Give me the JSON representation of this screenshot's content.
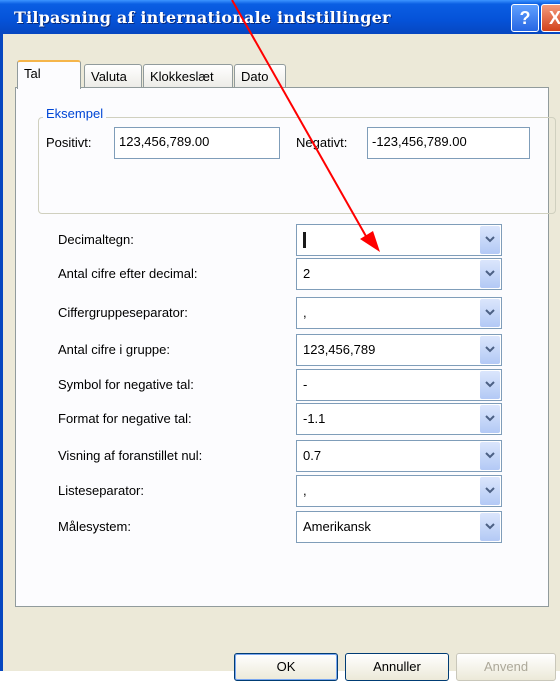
{
  "window": {
    "title": "Tilpasning af internationale indstillinger",
    "help_icon": "?",
    "close_icon": "X"
  },
  "tabs": [
    {
      "label": "Tal",
      "active": true
    },
    {
      "label": "Valuta",
      "active": false
    },
    {
      "label": "Klokkeslæt",
      "active": false
    },
    {
      "label": "Dato",
      "active": false
    }
  ],
  "example": {
    "group_label": "Eksempel",
    "positive_label": "Positivt:",
    "positive_value": "123,456,789.00",
    "negative_label": "Negativt:",
    "negative_value": "-123,456,789.00"
  },
  "settings": [
    {
      "label": "Decimaltegn:",
      "value": ""
    },
    {
      "label": "Antal cifre efter decimal:",
      "value": "2"
    },
    {
      "label": "Ciffergruppeseparator:",
      "value": ","
    },
    {
      "label": "Antal cifre i gruppe:",
      "value": "123,456,789"
    },
    {
      "label": "Symbol for negative tal:",
      "value": "-"
    },
    {
      "label": "Format for negative tal:",
      "value": "-1.1"
    },
    {
      "label": "Visning af foranstillet nul:",
      "value": "0.7"
    },
    {
      "label": "Listeseparator:",
      "value": ","
    },
    {
      "label": "Målesystem:",
      "value": "Amerikansk"
    }
  ],
  "buttons": {
    "ok": "OK",
    "cancel": "Annuller",
    "apply": "Anvend"
  },
  "colors": {
    "titlebar": "#0552d8",
    "annotation_arrow": "#ff0000"
  }
}
